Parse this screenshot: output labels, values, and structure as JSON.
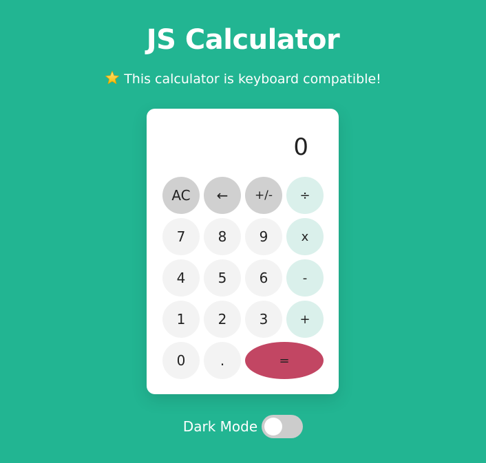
{
  "header": {
    "title": "JS Calculator",
    "subtitle": "This calculator is keyboard compatible!",
    "subtitle_icon": "star-icon"
  },
  "calculator": {
    "display": "0",
    "keys": {
      "ac": "AC",
      "backspace": "←",
      "sign": "+/-",
      "divide": "÷",
      "seven": "7",
      "eight": "8",
      "nine": "9",
      "multiply": "x",
      "four": "4",
      "five": "5",
      "six": "6",
      "subtract": "-",
      "one": "1",
      "two": "2",
      "three": "3",
      "add": "+",
      "zero": "0",
      "decimal": ".",
      "equals": "="
    }
  },
  "settings": {
    "dark_mode_label": "Dark Mode",
    "dark_mode_on": false
  },
  "colors": {
    "background": "#22b592",
    "function_key": "#d0d0d0",
    "number_key": "#f3f3f3",
    "operator_key": "#daf0eb",
    "equals_key": "#c24663"
  }
}
